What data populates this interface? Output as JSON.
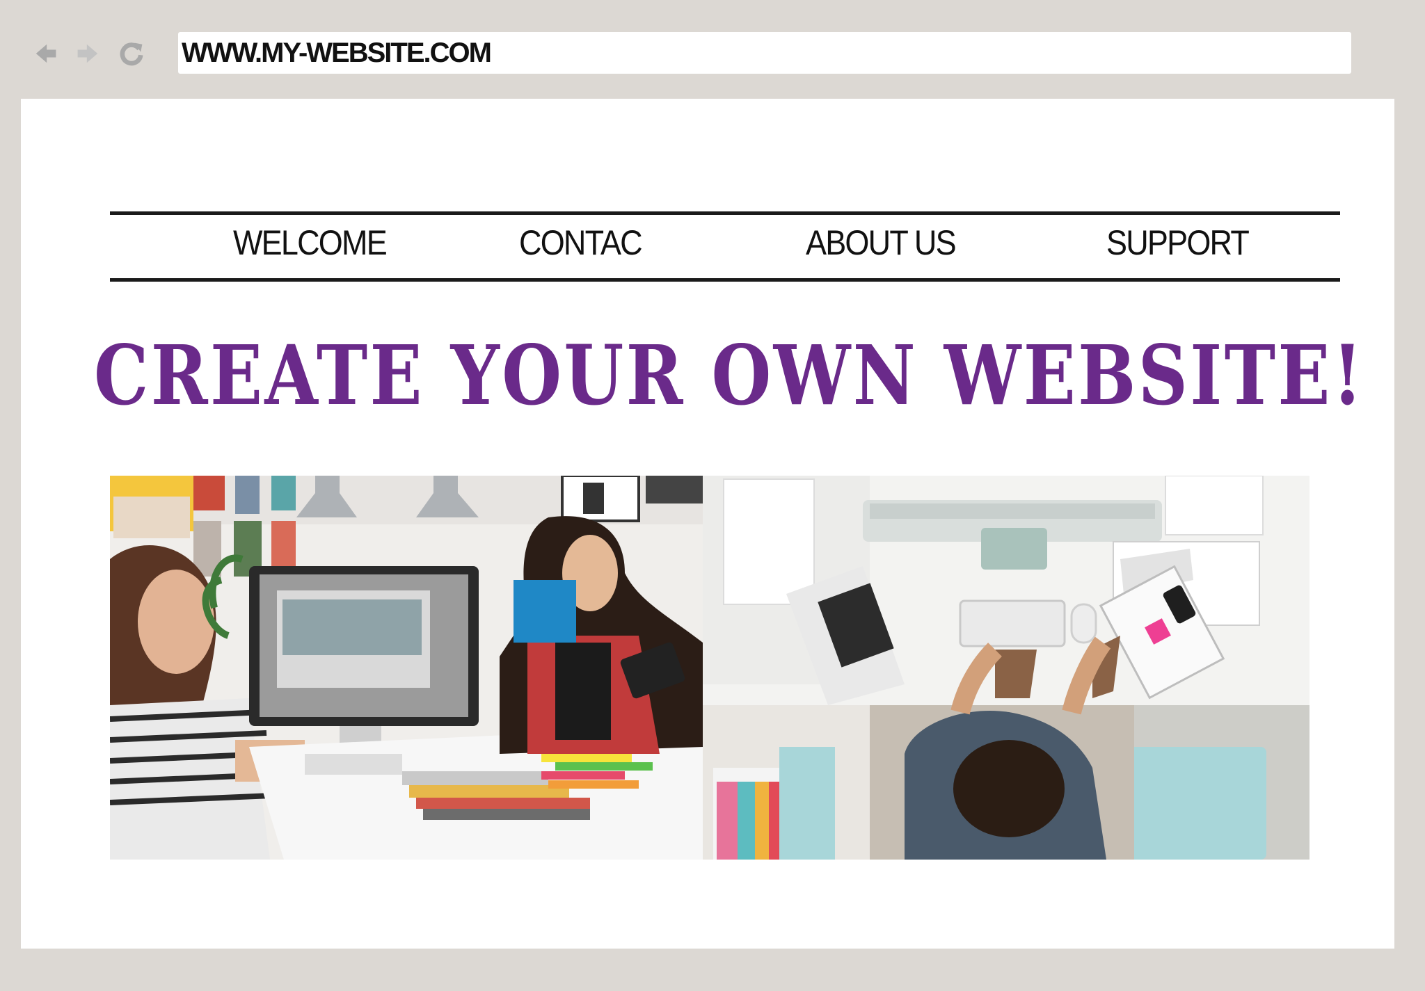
{
  "browser": {
    "back_icon": "back-arrow-icon",
    "forward_icon": "forward-arrow-icon",
    "reload_icon": "reload-icon",
    "url": "WWW.MY-WEBSITE.COM"
  },
  "page": {
    "nav": [
      "WELCOME",
      "CONTAC",
      "ABOUT US",
      "SUPPORT"
    ],
    "headline": "CREATE YOUR OWN WEBSITE!",
    "headline_color": "#6a2a8a",
    "photos": [
      "designers-office-photo",
      "top-down-desk-photo"
    ]
  }
}
